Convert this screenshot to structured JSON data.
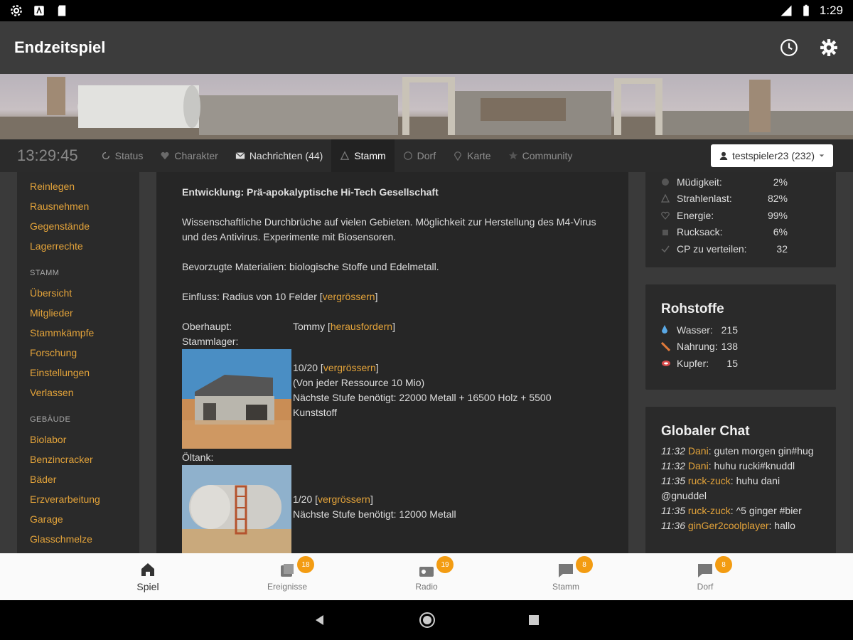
{
  "statusbar": {
    "time": "1:29"
  },
  "appbar": {
    "title": "Endzeitspiel"
  },
  "navbar": {
    "clock": "13:29:45",
    "items": [
      {
        "label": "Status",
        "icon": "refresh-icon"
      },
      {
        "label": "Charakter",
        "icon": "heart-icon"
      },
      {
        "label": "Nachrichten (44)",
        "icon": "envelope-icon"
      },
      {
        "label": "Stamm",
        "icon": "tribe-icon"
      },
      {
        "label": "Dorf",
        "icon": "globe-icon"
      },
      {
        "label": "Karte",
        "icon": "marker-icon"
      },
      {
        "label": "Community",
        "icon": "star-icon"
      }
    ],
    "user": "testspieler23 (232)"
  },
  "sidebar": {
    "group1": [
      "Reinlegen",
      "Rausnehmen",
      "Gegenstände",
      "Lagerrechte"
    ],
    "stamm_head": "STAMM",
    "stamm": [
      "Übersicht",
      "Mitglieder",
      "Stammkämpfe",
      "Forschung",
      "Einstellungen",
      "Verlassen"
    ],
    "gebaeude_head": "GEBÄUDE",
    "gebaeude": [
      "Biolabor",
      "Benzincracker",
      "Bäder",
      "Erzverarbeitung",
      "Garage",
      "Glasschmelze"
    ]
  },
  "content": {
    "entwicklung": "Entwicklung: Prä-apokalyptische Hi-Tech Gesellschaft",
    "beschreibung": "Wissenschaftliche Durchbrüche auf vielen Gebieten. Möglichkeit zur Herstellung des M4-Virus und des Antivirus. Experimente mit Biosensoren.",
    "materialien": "Bevorzugte Materialien: biologische Stoffe und Edelmetall.",
    "einfluss": "Einfluss: Radius von 10 Felder [",
    "einfluss_link": "vergrössern",
    "oberhaupt_label": "Oberhaupt:",
    "oberhaupt_name": "Tommy [",
    "oberhaupt_link": "herausfordern",
    "stammlager_label": "Stammlager:",
    "stammlager_level": "10/20 [",
    "stammlager_link": "vergrössern",
    "stammlager_info": "(Von jeder Ressource 10 Mio)",
    "stammlager_next": "Nächste Stufe benötigt: 22000 Metall + 16500 Holz + 5500 Kunststoff",
    "oeltank_label": "Öltank:",
    "oeltank_level": "1/20 [",
    "oeltank_link": "vergrössern",
    "oeltank_next": "Nächste Stufe benötigt: 12000 Metall"
  },
  "stats": [
    {
      "label": "Müdigkeit:",
      "value": "2%"
    },
    {
      "label": "Strahlenlast:",
      "value": "82%"
    },
    {
      "label": "Energie:",
      "value": "99%"
    },
    {
      "label": "Rucksack:",
      "value": "6%"
    },
    {
      "label": "CP zu verteilen:",
      "value": "32"
    }
  ],
  "rohstoffe": {
    "title": "Rohstoffe",
    "items": [
      {
        "label": "Wasser:",
        "value": "215",
        "color": "#5aa9e6"
      },
      {
        "label": "Nahrung:",
        "value": "138",
        "color": "#e07a3a"
      },
      {
        "label": "Kupfer:",
        "value": "15",
        "color": "#d94b4b"
      }
    ]
  },
  "chat": {
    "title": "Globaler Chat",
    "messages": [
      {
        "time": "11:32",
        "name": "Dani",
        "text": ": guten morgen gin#hug"
      },
      {
        "time": "11:32",
        "name": "Dani",
        "text": ": huhu rucki#knuddl"
      },
      {
        "time": "11:35",
        "name": "ruck-zuck",
        "text": ": huhu dani @gnuddel"
      },
      {
        "time": "11:35",
        "name": "ruck-zuck",
        "text": ": ^5 ginger #bier"
      },
      {
        "time": "11:36",
        "name": "ginGer2coolplayer",
        "text": ": hallo"
      }
    ]
  },
  "tabs": [
    {
      "label": "Spiel",
      "badge": "",
      "icon": "home-icon"
    },
    {
      "label": "Ereignisse",
      "badge": "18",
      "icon": "events-icon"
    },
    {
      "label": "Radio",
      "badge": "19",
      "icon": "radio-icon"
    },
    {
      "label": "Stamm",
      "badge": "8",
      "icon": "chat-icon"
    },
    {
      "label": "Dorf",
      "badge": "8",
      "icon": "chat-icon"
    }
  ],
  "colors": {
    "accent": "#e3a33a",
    "badge": "#f39c12",
    "appbar": "#3c3c3c"
  }
}
